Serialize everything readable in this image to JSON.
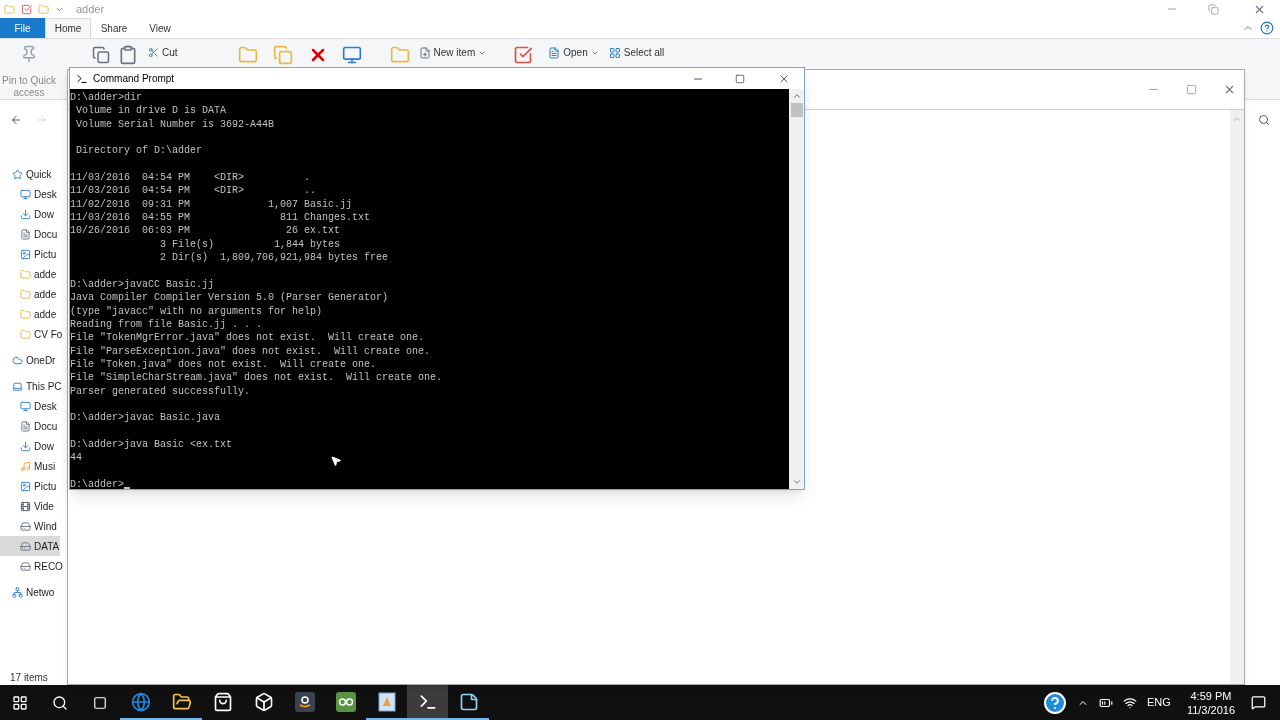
{
  "explorer": {
    "title": "adder",
    "tabs": [
      {
        "label": "File",
        "kind": "file",
        "selected": false
      },
      {
        "label": "Home",
        "kind": "tab",
        "selected": true
      },
      {
        "label": "Share",
        "kind": "tab",
        "selected": false
      },
      {
        "label": "View",
        "kind": "tab",
        "selected": false
      }
    ],
    "ribbon": {
      "pin": "Pin to Quick access",
      "cut": "Cut",
      "new_item": "New item",
      "open": "Open",
      "select_all": "Select all"
    },
    "nav": [
      {
        "label": "Quick",
        "kind": "star",
        "selected": false,
        "children": [
          {
            "label": "Desk",
            "kind": "desktop",
            "selected": false
          },
          {
            "label": "Dow",
            "kind": "download",
            "selected": false
          },
          {
            "label": "Docu",
            "kind": "document",
            "selected": false
          },
          {
            "label": "Pictu",
            "kind": "picture",
            "selected": false
          },
          {
            "label": "adde",
            "kind": "folder",
            "selected": false
          },
          {
            "label": "adde",
            "kind": "folder",
            "selected": false
          },
          {
            "label": "adde",
            "kind": "folder",
            "selected": false
          },
          {
            "label": "CV Fo",
            "kind": "folder",
            "selected": false
          }
        ]
      },
      {
        "label": "OneDr",
        "kind": "cloud",
        "selected": false
      },
      {
        "label": "This PC",
        "kind": "pc",
        "selected": false,
        "children": [
          {
            "label": "Desk",
            "kind": "desktop",
            "selected": false
          },
          {
            "label": "Docu",
            "kind": "document",
            "selected": false
          },
          {
            "label": "Dow",
            "kind": "download",
            "selected": false
          },
          {
            "label": "Musi",
            "kind": "music",
            "selected": false
          },
          {
            "label": "Pictu",
            "kind": "picture",
            "selected": false
          },
          {
            "label": "Vide",
            "kind": "video",
            "selected": false
          },
          {
            "label": "Wind",
            "kind": "drive",
            "selected": false
          },
          {
            "label": "DATA",
            "kind": "drive",
            "selected": true
          },
          {
            "label": "RECO",
            "kind": "drive",
            "selected": false
          }
        ]
      },
      {
        "label": "Netwo",
        "kind": "network",
        "selected": false
      }
    ],
    "status": "17 items"
  },
  "cmd": {
    "title": "Command Prompt",
    "blocks": [
      [
        "D:\\adder>dir",
        " Volume in drive D is DATA",
        " Volume Serial Number is 3692-A44B"
      ],
      [
        " Directory of D:\\adder"
      ],
      [
        "11/03/2016  04:54 PM    <DIR>          .",
        "11/03/2016  04:54 PM    <DIR>          ..",
        "11/02/2016  09:31 PM             1,007 Basic.jj",
        "11/03/2016  04:55 PM               811 Changes.txt",
        "10/26/2016  06:03 PM                26 ex.txt",
        "               3 File(s)          1,844 bytes",
        "               2 Dir(s)  1,809,706,921,984 bytes free"
      ],
      [
        "D:\\adder>javaCC Basic.jj",
        "Java Compiler Compiler Version 5.0 (Parser Generator)",
        "(type \"javacc\" with no arguments for help)",
        "Reading from file Basic.jj . . .",
        "File \"TokenMgrError.java\" does not exist.  Will create one.",
        "File \"ParseException.java\" does not exist.  Will create one.",
        "File \"Token.java\" does not exist.  Will create one.",
        "File \"SimpleCharStream.java\" does not exist.  Will create one.",
        "Parser generated successfully."
      ],
      [
        "D:\\adder>javac Basic.java"
      ],
      [
        "D:\\adder>java Basic <ex.txt",
        "44"
      ]
    ],
    "prompt": "D:\\adder>"
  },
  "taskbar": {
    "apps": [
      {
        "kind": "edge",
        "running": true,
        "active": false
      },
      {
        "kind": "explorer",
        "running": true,
        "active": false
      },
      {
        "kind": "store",
        "running": false,
        "active": false
      },
      {
        "kind": "dropbox",
        "running": false,
        "active": false
      },
      {
        "kind": "amazon",
        "running": false,
        "active": false
      },
      {
        "kind": "owl",
        "running": false,
        "active": false
      },
      {
        "kind": "viewer",
        "running": true,
        "active": false
      },
      {
        "kind": "console",
        "running": true,
        "active": true
      },
      {
        "kind": "notepad",
        "running": true,
        "active": false
      }
    ],
    "tray": {
      "language": "ENG",
      "time": "4:59 PM",
      "date": "11/3/2016"
    }
  }
}
